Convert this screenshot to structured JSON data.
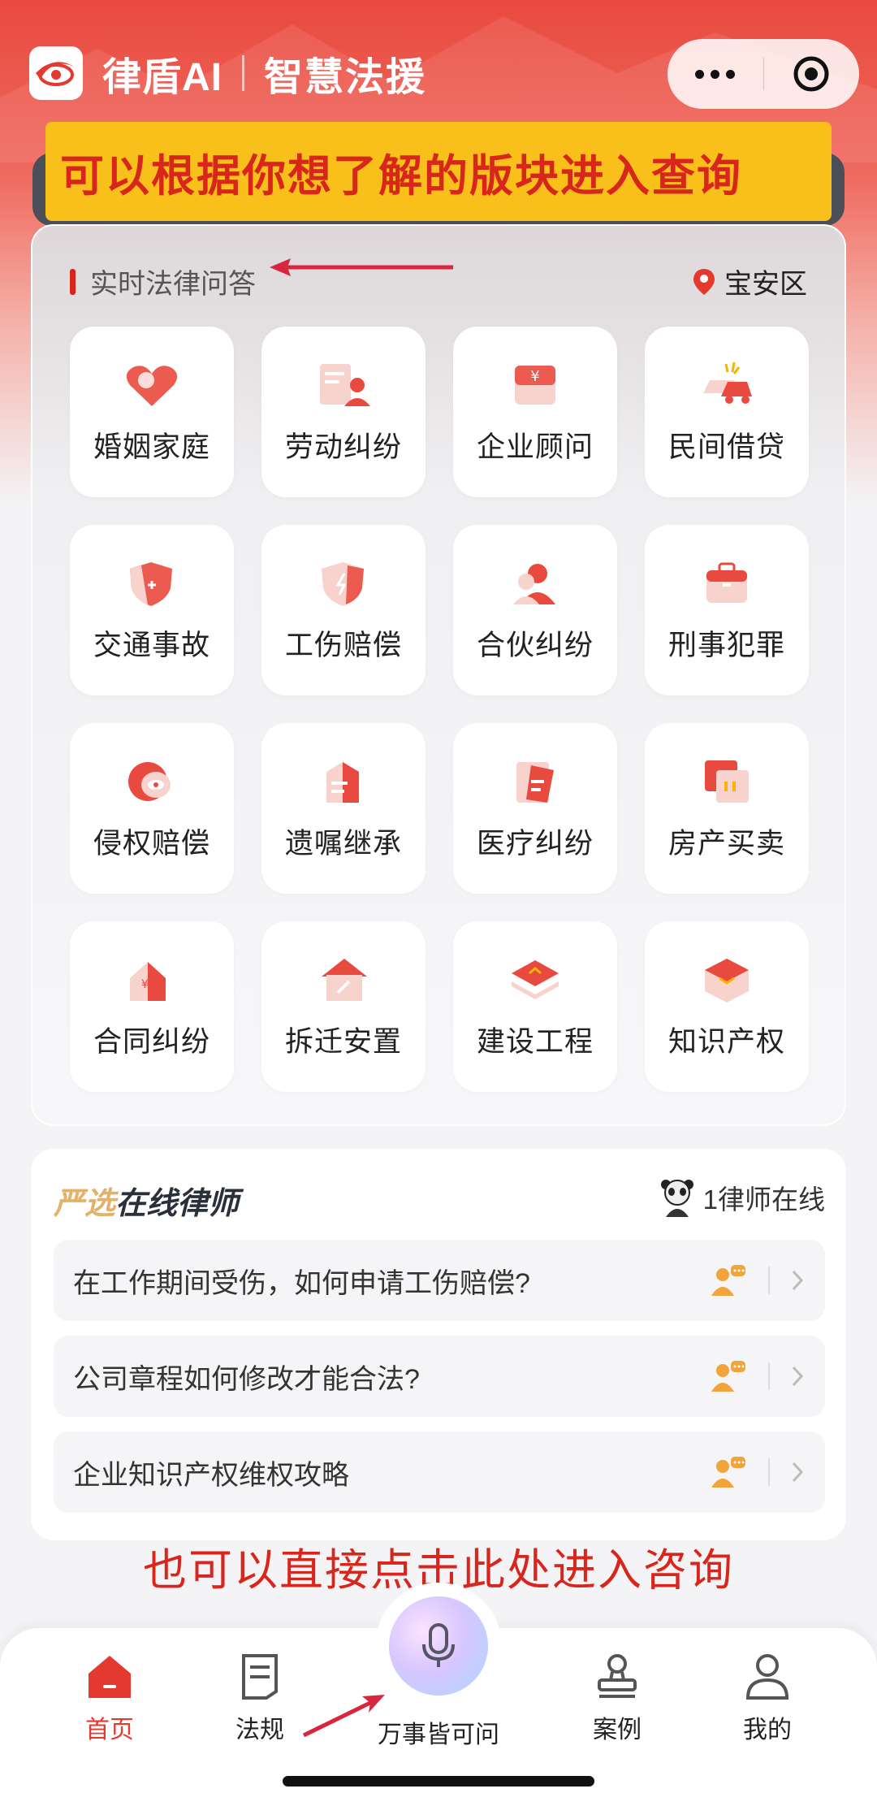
{
  "header": {
    "brand": "律盾AI",
    "subtitle": "智慧法援",
    "more_icon": "more-dots-icon",
    "close_icon": "target-circle-icon"
  },
  "annotations": {
    "top": "可以根据你想了解的版块进入查询",
    "bottom": "也可以直接点击此处进入咨询"
  },
  "legal_qa": {
    "title": "实时法律问答",
    "location": "宝安区",
    "categories": [
      {
        "label": "婚姻家庭",
        "icon": "heart-ring-icon"
      },
      {
        "label": "劳动纠纷",
        "icon": "worker-document-icon"
      },
      {
        "label": "企业顾问",
        "icon": "yuan-bag-icon"
      },
      {
        "label": "民间借贷",
        "icon": "car-crash-icon"
      },
      {
        "label": "交通事故",
        "icon": "shield-plus-icon"
      },
      {
        "label": "工伤赔偿",
        "icon": "shield-bolt-icon"
      },
      {
        "label": "合伙纠纷",
        "icon": "partner-person-icon"
      },
      {
        "label": "刑事犯罪",
        "icon": "briefcase-icon"
      },
      {
        "label": "侵权赔偿",
        "icon": "eye-circle-icon"
      },
      {
        "label": "遗嘱继承",
        "icon": "will-document-icon"
      },
      {
        "label": "医疗纠纷",
        "icon": "medical-file-icon"
      },
      {
        "label": "房产买卖",
        "icon": "house-deed-icon"
      },
      {
        "label": "合同纠纷",
        "icon": "contract-house-icon"
      },
      {
        "label": "拆迁安置",
        "icon": "demolition-house-icon"
      },
      {
        "label": "建设工程",
        "icon": "construction-layers-icon"
      },
      {
        "label": "知识产权",
        "icon": "ip-cube-icon"
      }
    ]
  },
  "lawyers": {
    "title_part1": "严选",
    "title_part2": "在线律师",
    "online_text": "1律师在线",
    "questions": [
      "在工作期间受伤，如何申请工伤赔偿?",
      "公司章程如何修改才能合法?",
      "企业知识产权维权攻略"
    ]
  },
  "tabbar": {
    "items": [
      {
        "label": "首页",
        "icon": "home-icon",
        "active": true
      },
      {
        "label": "法规",
        "icon": "regulation-doc-icon",
        "active": false
      },
      {
        "label": "万事皆可问",
        "icon": "microphone-icon",
        "active": false
      },
      {
        "label": "案例",
        "icon": "case-stamp-icon",
        "active": false
      },
      {
        "label": "我的",
        "icon": "user-icon",
        "active": false
      }
    ]
  },
  "colors": {
    "brand_red": "#e4392f",
    "annotation_yellow": "#f9c01b",
    "annotation_red": "#d8261c"
  }
}
